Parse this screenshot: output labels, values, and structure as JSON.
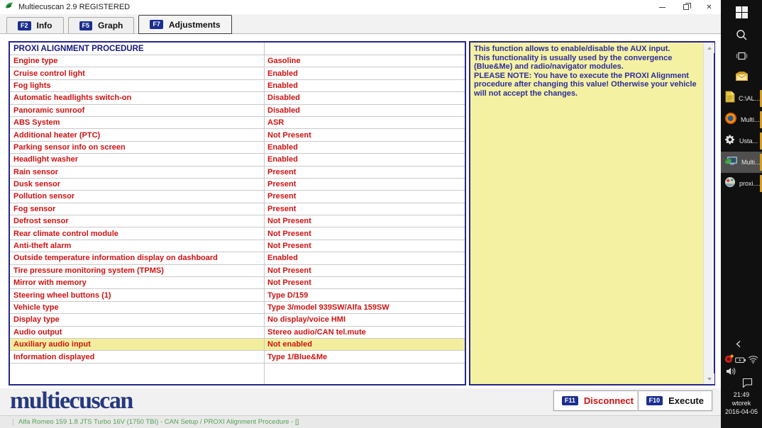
{
  "window": {
    "title": "Multiecuscan 2.9 REGISTERED"
  },
  "tabs": [
    {
      "key": "F2",
      "label": "Info",
      "active": false
    },
    {
      "key": "F5",
      "label": "Graph",
      "active": false
    },
    {
      "key": "F7",
      "label": "Adjustments",
      "active": true
    }
  ],
  "table": {
    "header": "PROXI ALIGNMENT PROCEDURE",
    "rows": [
      {
        "label": "Engine type",
        "value": "Gasoline"
      },
      {
        "label": "Cruise control light",
        "value": "Enabled"
      },
      {
        "label": "Fog lights",
        "value": "Enabled"
      },
      {
        "label": "Automatic headlights switch-on",
        "value": "Disabled"
      },
      {
        "label": "Panoramic sunroof",
        "value": "Disabled"
      },
      {
        "label": "ABS System",
        "value": "ASR"
      },
      {
        "label": "Additional heater (PTC)",
        "value": "Not Present"
      },
      {
        "label": "Parking sensor info on screen",
        "value": "Enabled"
      },
      {
        "label": "Headlight washer",
        "value": "Enabled"
      },
      {
        "label": "Rain sensor",
        "value": "Present"
      },
      {
        "label": "Dusk sensor",
        "value": "Present"
      },
      {
        "label": "Pollution sensor",
        "value": "Present"
      },
      {
        "label": "Fog sensor",
        "value": "Present"
      },
      {
        "label": "Defrost sensor",
        "value": "Not Present"
      },
      {
        "label": "Rear climate control module",
        "value": "Not Present"
      },
      {
        "label": "Anti-theft alarm",
        "value": "Not Present"
      },
      {
        "label": "Outside temperature information display on dashboard",
        "value": "Enabled"
      },
      {
        "label": "Tire pressure monitoring system (TPMS)",
        "value": "Not Present"
      },
      {
        "label": "Mirror with memory",
        "value": "Not Present"
      },
      {
        "label": "Steering wheel buttons (1)",
        "value": "Type D/159"
      },
      {
        "label": "Vehicle type",
        "value": "Type 3/model 939SW/Alfa 159SW"
      },
      {
        "label": "Display type",
        "value": "No display/voice HMI"
      },
      {
        "label": "Audio output",
        "value": "Stereo audio/CAN tel.mute"
      },
      {
        "label": "Auxiliary audio input",
        "value": "Not enabled",
        "highlight": true
      },
      {
        "label": "Information displayed",
        "value": "Type 1/Blue&Me"
      }
    ]
  },
  "info_panel": {
    "lines": [
      "This function allows to enable/disable the AUX input.",
      "This functionality is usually used by the convergence (Blue&Me) and radio/navigator modules.",
      "PLEASE NOTE: You have to execute the PROXI Alignment procedure after changing this value! Otherwise your vehicle will not accept the changes."
    ]
  },
  "buttons": [
    {
      "key": "F11",
      "label": "Disconnect"
    },
    {
      "key": "F10",
      "label": "Execute"
    }
  ],
  "logo_text": "multiecuscan",
  "status_text": "Alfa Romeo 159 1.8 JTS Turbo 16V (1750 TBI) - CAN Setup / PROXI Alignment Procedure - []",
  "colors": {
    "accent_navy": "#26268a",
    "value_red": "#cf1212",
    "panel_yellow": "#f4f1a3",
    "highlight_yellow": "#f2ee9d",
    "status_green": "#54a054",
    "running_indicator": "#d79f1e"
  },
  "taskbar": {
    "apps": [
      {
        "icon": "document-icon",
        "label": "C:\\AL...",
        "active": false,
        "running": true
      },
      {
        "icon": "firefox-icon",
        "label": "Multi...",
        "active": false,
        "running": true
      },
      {
        "icon": "gear-icon",
        "label": "Usta...",
        "active": false,
        "running": true
      },
      {
        "icon": "multiecuscan-icon",
        "label": "Multi...",
        "active": true,
        "running": true
      },
      {
        "icon": "proxi-icon",
        "label": "proxi....",
        "active": false,
        "running": true
      }
    ],
    "clock": {
      "time": "21:49",
      "day": "wtorek",
      "date": "2016-04-05"
    }
  }
}
